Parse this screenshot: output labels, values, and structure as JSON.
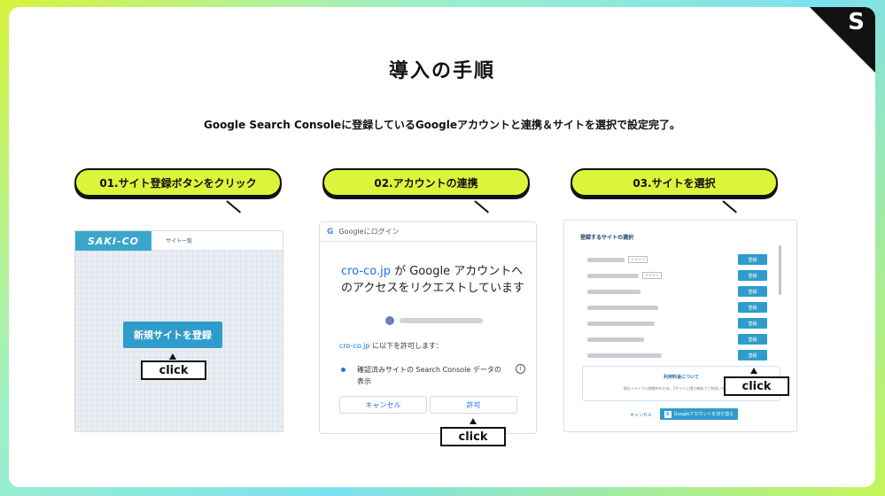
{
  "corner_label": "S",
  "title": "導入の手順",
  "subtitle": "Google Search Consoleに登録しているGoogleアカウントと連携＆サイトを選択で設定完了。",
  "steps": [
    {
      "label": "01.サイト登録ボタンをクリック"
    },
    {
      "label": "02.アカウントの連携"
    },
    {
      "label": "03.サイトを選択"
    }
  ],
  "click_label": "click",
  "panel1": {
    "logo": "SAKI-CO",
    "nav_link": "サイト一覧",
    "button": "新規サイトを登録"
  },
  "panel2": {
    "bar_icon": "G",
    "bar_text": "Googleにログイン",
    "domain": "cro-co.jp",
    "heading_rest": " が Google アカウントへのアクセスをリクエストしています",
    "perm_rest": " に以下を許可します：",
    "item_text": "確認済みサイトの Search Console データの表示",
    "info": "i",
    "cancel": "キャンセル",
    "allow": "許可"
  },
  "panel3": {
    "title": "登録するサイトの選択",
    "reg_label": "登録",
    "tag_label": "ドメイン",
    "notice_title": "利用料金について",
    "notice_body": "現在トライアル期間中のため、1サイトに限り無料でご利用いただけます",
    "cancel": "キャンセル",
    "gbtn_icon": "S",
    "gbtn": "Googleアカウントを切り替え"
  },
  "colors": {
    "accent": "#dcf53a",
    "blue": "#2f9ccc",
    "dark": "#111111"
  }
}
